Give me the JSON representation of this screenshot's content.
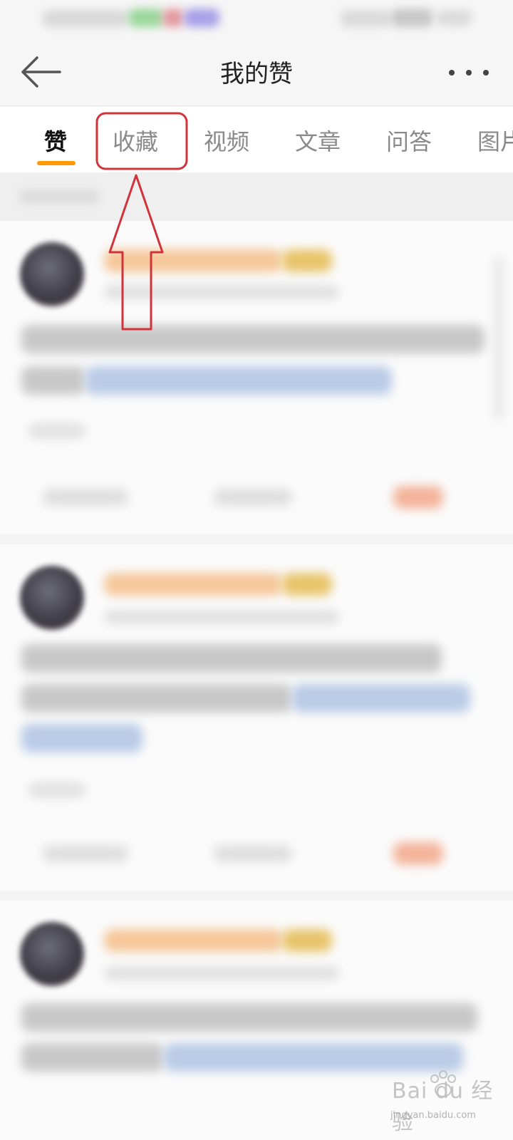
{
  "header": {
    "title": "我的赞",
    "back_icon": "arrow-left-icon",
    "more_icon": "more-horizontal-icon"
  },
  "tabs": [
    {
      "label": "赞",
      "active": true
    },
    {
      "label": "收藏",
      "active": false
    },
    {
      "label": "视频",
      "active": false
    },
    {
      "label": "文章",
      "active": false
    },
    {
      "label": "问答",
      "active": false
    },
    {
      "label": "图片",
      "active": false
    }
  ],
  "colors": {
    "accent": "#ff9a00",
    "annotation_red": "#d0343a",
    "title_text": "#222222",
    "tab_inactive": "#8a8a8a"
  },
  "watermark": {
    "brand": "Bai du 经验",
    "site": "jingyan.baidu.com"
  }
}
